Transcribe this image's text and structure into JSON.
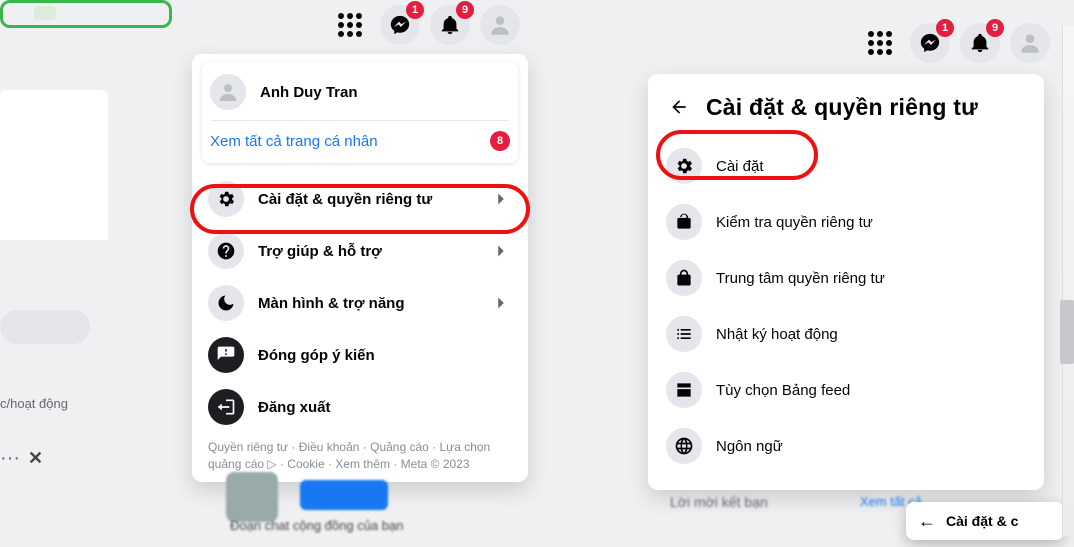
{
  "left_hints": {
    "activity_text": "c/hoạt động",
    "bottom_caption": "Đoạn chat cộng đồng của bạn"
  },
  "topbar": {
    "messenger_badge": "1",
    "notifications_badge": "9"
  },
  "panel1": {
    "user_name": "Anh Duy Tran",
    "see_all_profiles": "Xem tất cả trang cá nhân",
    "see_all_badge": "8",
    "items": [
      {
        "label": "Cài đặt & quyền riêng tư",
        "icon": "gear",
        "chevron": true,
        "highlight": true
      },
      {
        "label": "Trợ giúp & hỗ trợ",
        "icon": "help",
        "chevron": true,
        "highlight": false
      },
      {
        "label": "Màn hình & trợ năng",
        "icon": "moon",
        "chevron": true,
        "highlight": false
      },
      {
        "label": "Đóng góp ý kiến",
        "icon": "feedback",
        "chevron": false,
        "highlight": false
      },
      {
        "label": "Đăng xuất",
        "icon": "logout",
        "chevron": false,
        "highlight": false
      }
    ],
    "footer": "Quyền riêng tư · Điều khoản · Quảng cáo · Lựa chọn quảng cáo ▷ · Cookie · Xem thêm · Meta © 2023"
  },
  "panel2": {
    "title": "Cài đặt & quyền riêng tư",
    "items": [
      {
        "label": "Cài đặt",
        "icon": "gear",
        "highlight": true
      },
      {
        "label": "Kiểm tra quyền riêng tư",
        "icon": "unlock",
        "highlight": false
      },
      {
        "label": "Trung tâm quyền riêng tư",
        "icon": "lock",
        "highlight": false
      },
      {
        "label": "Nhật ký hoạt động",
        "icon": "list",
        "highlight": false
      },
      {
        "label": "Tùy chọn Bảng feed",
        "icon": "feed",
        "highlight": false
      },
      {
        "label": "Ngôn ngữ",
        "icon": "globe",
        "highlight": false
      }
    ]
  },
  "bottom": {
    "blur_left": "Lời mời kết bạn",
    "blur_right": "Xem tất cả",
    "mini_title": "Cài đặt & c"
  }
}
